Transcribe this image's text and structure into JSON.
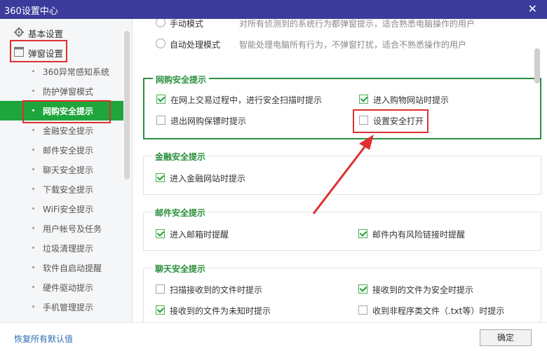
{
  "window": {
    "title": "360设置中心",
    "close_glyph": "✕"
  },
  "sidebar": {
    "categories": [
      {
        "label": "基本设置",
        "icon": "gear-icon"
      },
      {
        "label": "弹窗设置",
        "icon": "window-icon"
      }
    ],
    "items": [
      {
        "label": "360异常感知系统"
      },
      {
        "label": "防护弹窗模式"
      },
      {
        "label": "网购安全提示",
        "active": true
      },
      {
        "label": "金融安全提示"
      },
      {
        "label": "邮件安全提示"
      },
      {
        "label": "聊天安全提示"
      },
      {
        "label": "下载安全提示"
      },
      {
        "label": "WiFi安全提示"
      },
      {
        "label": "用户帐号及任务"
      },
      {
        "label": "垃圾清理提示"
      },
      {
        "label": "软件自启动提醒"
      },
      {
        "label": "硬件驱动提示"
      },
      {
        "label": "手机管理提示"
      }
    ]
  },
  "mode": {
    "manual": {
      "label": "手动模式",
      "desc": "对所有侦测到的系统行为都弹窗提示，适合熟悉电脑操作的用户"
    },
    "auto": {
      "label": "自动处理模式",
      "desc": "智能处理电脑所有行为，不弹窗打扰，适合不熟悉操作的用户"
    }
  },
  "groups": {
    "shopping": {
      "title": "网购安全提示",
      "options": [
        {
          "label": "在网上交易过程中，进行安全扫描时提示",
          "checked": true
        },
        {
          "label": "进入购物网站时提示",
          "checked": true
        },
        {
          "label": "退出网购保镖时提示",
          "checked": false
        },
        {
          "label": "设置安全打开",
          "checked": false
        }
      ]
    },
    "finance": {
      "title": "金融安全提示",
      "options": [
        {
          "label": "进入金融网站时提示",
          "checked": true
        }
      ]
    },
    "mail": {
      "title": "邮件安全提示",
      "options": [
        {
          "label": "进入邮箱时提醒",
          "checked": true
        },
        {
          "label": "邮件内有风险链接时提醒",
          "checked": true
        }
      ]
    },
    "chat": {
      "title": "聊天安全提示",
      "options": [
        {
          "label": "扫描接收到的文件时提示",
          "checked": false
        },
        {
          "label": "接收到的文件为安全时提示",
          "checked": true
        },
        {
          "label": "接收到的文件为未知时提示",
          "checked": true
        },
        {
          "label": "收到非程序类文件（.txt等）时提示",
          "checked": false
        }
      ]
    }
  },
  "footer": {
    "reset_label": "恢复所有默认值",
    "ok_label": "确定"
  },
  "colors": {
    "titlebar": "#3b3b9c",
    "accent_green": "#1ea53b",
    "annotation_red": "#e03030",
    "link_blue": "#2e6db6"
  }
}
